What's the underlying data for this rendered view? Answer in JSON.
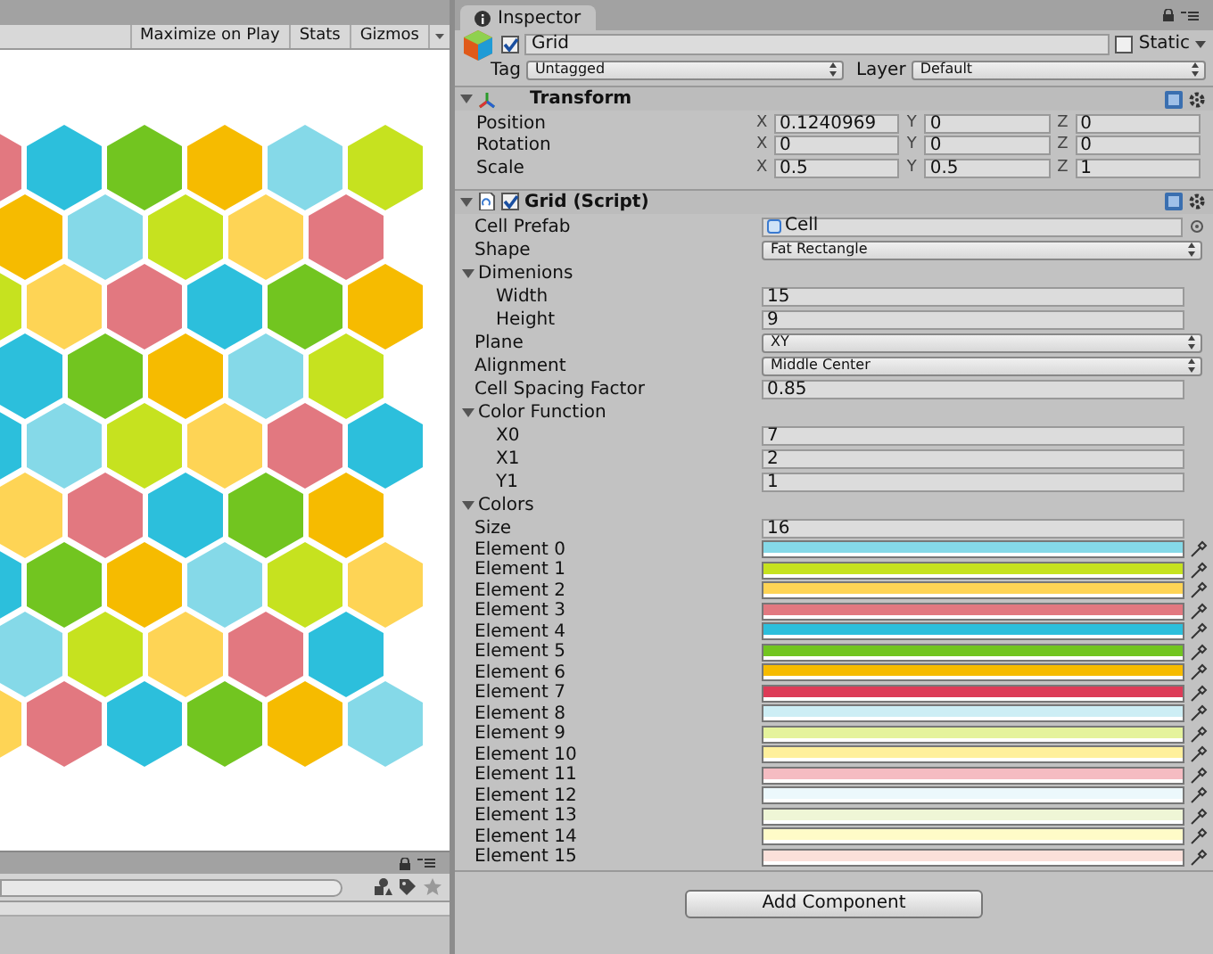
{
  "game_view": {
    "toolbar": [
      "Maximize on Play",
      "Stats",
      "Gizmos"
    ]
  },
  "inspector": {
    "tab": "Inspector",
    "object": {
      "active": true,
      "name": "Grid",
      "static_label": "Static",
      "static": false,
      "tag_label": "Tag",
      "tag": "Untagged",
      "layer_label": "Layer",
      "layer": "Default"
    },
    "transform": {
      "title": "Transform",
      "expanded": true,
      "rows": [
        {
          "label": "Position",
          "values": [
            {
              "axis": "X",
              "value": "0.1240969"
            },
            {
              "axis": "Y",
              "value": "0"
            },
            {
              "axis": "Z",
              "value": "0"
            }
          ]
        },
        {
          "label": "Rotation",
          "values": [
            {
              "axis": "X",
              "value": "0"
            },
            {
              "axis": "Y",
              "value": "0"
            },
            {
              "axis": "Z",
              "value": "0"
            }
          ]
        },
        {
          "label": "Scale",
          "values": [
            {
              "axis": "X",
              "value": "0.5"
            },
            {
              "axis": "Y",
              "value": "0.5"
            },
            {
              "axis": "Z",
              "value": "1"
            }
          ]
        }
      ]
    },
    "script": {
      "title": "Grid (Script)",
      "enabled": true,
      "expanded": true,
      "fields": [
        {
          "kind": "object",
          "label": "Cell Prefab",
          "value": "Cell"
        },
        {
          "kind": "dropdown",
          "label": "Shape",
          "value": "Fat Rectangle"
        },
        {
          "kind": "group",
          "label": "Dimenions",
          "expanded": true,
          "children": [
            {
              "kind": "text",
              "label": "Width",
              "value": "15"
            },
            {
              "kind": "text",
              "label": "Height",
              "value": "9"
            }
          ]
        },
        {
          "kind": "dropdown",
          "label": "Plane",
          "value": "XY"
        },
        {
          "kind": "dropdown",
          "label": "Alignment",
          "value": "Middle Center"
        },
        {
          "kind": "text",
          "label": "Cell Spacing Factor",
          "value": "0.85"
        },
        {
          "kind": "group",
          "label": "Color Function",
          "expanded": true,
          "children": [
            {
              "kind": "text",
              "label": "X0",
              "value": "7"
            },
            {
              "kind": "text",
              "label": "X1",
              "value": "2"
            },
            {
              "kind": "text",
              "label": "Y1",
              "value": "1"
            }
          ]
        },
        {
          "kind": "array",
          "label": "Colors",
          "expanded": true,
          "children": [
            {
              "kind": "text",
              "label": "Size",
              "value": "16"
            },
            {
              "kind": "color",
              "label": "Element 0",
              "color": "#85d9e8"
            },
            {
              "kind": "color",
              "label": "Element 1",
              "color": "#c6e21f"
            },
            {
              "kind": "color",
              "label": "Element 2",
              "color": "#fed455"
            },
            {
              "kind": "color",
              "label": "Element 3",
              "color": "#e27880"
            },
            {
              "kind": "color",
              "label": "Element 4",
              "color": "#2cbfdc"
            },
            {
              "kind": "color",
              "label": "Element 5",
              "color": "#72c520"
            },
            {
              "kind": "color",
              "label": "Element 6",
              "color": "#f6bb00"
            },
            {
              "kind": "color",
              "label": "Element 7",
              "color": "#dd3b57"
            },
            {
              "kind": "color",
              "label": "Element 8",
              "color": "#cdeef5"
            },
            {
              "kind": "color",
              "label": "Element 9",
              "color": "#e5f39c"
            },
            {
              "kind": "color",
              "label": "Element 10",
              "color": "#fff09c"
            },
            {
              "kind": "color",
              "label": "Element 11",
              "color": "#f5bcc2"
            },
            {
              "kind": "color",
              "label": "Element 12",
              "color": "#ecf8fc"
            },
            {
              "kind": "color",
              "label": "Element 13",
              "color": "#eff6d6"
            },
            {
              "kind": "color",
              "label": "Element 14",
              "color": "#fffbc8"
            },
            {
              "kind": "color",
              "label": "Element 15",
              "color": "#fbe0da"
            }
          ]
        }
      ]
    },
    "add_component": "Add Component"
  }
}
